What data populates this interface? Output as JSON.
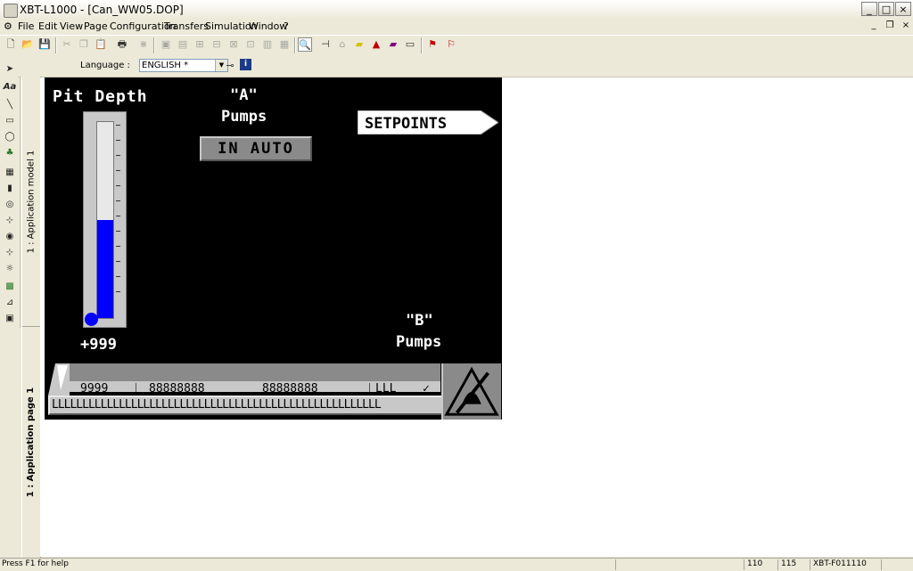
{
  "window": {
    "title": "XBT-L1000 - [Can_WW05.DOP]",
    "minimize": "_",
    "maximize": "□",
    "close": "×"
  },
  "menu": {
    "items": [
      "File",
      "Edit",
      "View",
      "Page",
      "Configuration",
      "Transfers",
      "Simulation",
      "Window",
      "?"
    ],
    "mdi_minimize": "_",
    "mdi_restore": "❐",
    "mdi_close": "×"
  },
  "language": {
    "label": "Language :",
    "value": "ENGLISH *"
  },
  "tabs": {
    "model": "1 : Application model 1",
    "page": "1 : Application page 1"
  },
  "hmi": {
    "pit_label": "Pit Depth",
    "pit_value": "+999",
    "level_fraction": 0.5,
    "a_quote": "\"A\"",
    "a_pumps": "Pumps",
    "b_quote": "\"B\"",
    "b_pumps": "Pumps",
    "status_button": "IN AUTO",
    "setpoints_label": "SETPOINTS",
    "alarm_fields": [
      "9999",
      "88888888",
      "88888888",
      "LLL",
      "✓"
    ],
    "alarm_message": "LLLLLLLLLLLLLLLLLLLLLLLLLLLLLLLLLLLLLLLLLLLLLLLLLLLLLL"
  },
  "status": {
    "help": "Press F1 for help",
    "x": "110",
    "y": "115",
    "terminal": "XBT-F011110"
  },
  "colors": {
    "hmi_background": "#000000",
    "bar_fill": "#0000ff",
    "panel_grey": "#c8c8c8"
  }
}
